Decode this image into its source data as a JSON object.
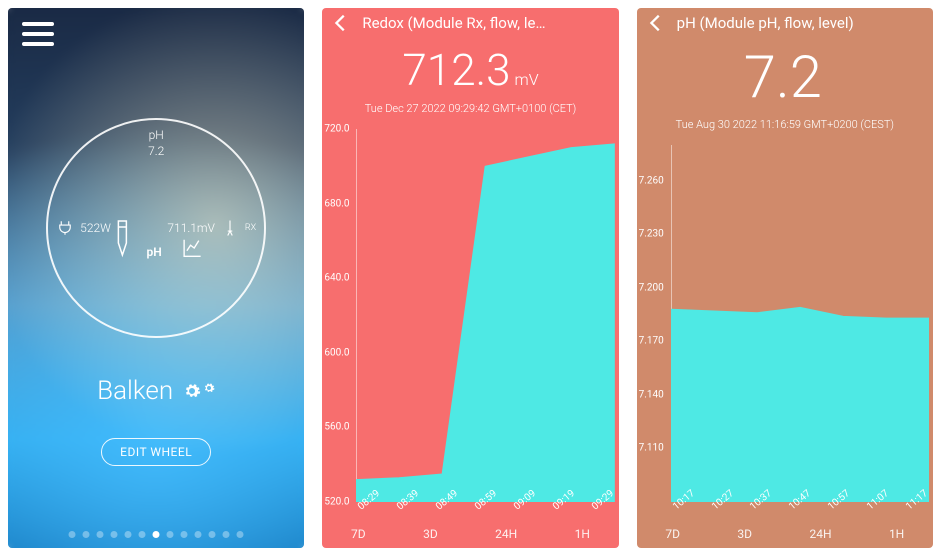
{
  "home": {
    "title": "Balken",
    "edit_label": "EDIT WHEEL",
    "wheel": {
      "ph_label": "pH",
      "ph_value": "7.2",
      "watt_value": "522W",
      "redox_value": "711.1mV",
      "rx_label": "RX",
      "center_ph_label": "pH"
    },
    "dots_total": 13,
    "dots_active_index": 6
  },
  "redox": {
    "title": "Redox (Module Rx, flow, le…",
    "value": "712.3",
    "unit": "mV",
    "timestamp": "Tue Dec 27 2022 09:29:42 GMT+0100 (CET)",
    "ranges": [
      "7D",
      "3D",
      "24H",
      "1H"
    ]
  },
  "ph": {
    "title": "pH (Module pH, flow, level)",
    "value": "7.2",
    "unit": "",
    "timestamp": "Tue Aug 30 2022 11:16:59 GMT+0200 (CEST)",
    "ranges": [
      "7D",
      "3D",
      "24H",
      "1H"
    ]
  },
  "chart_data": [
    {
      "type": "area",
      "title": "Redox (Module Rx, flow, level)",
      "ylabel": "mV",
      "ylim": [
        520,
        720
      ],
      "yticks": [
        520,
        560,
        600,
        640,
        680,
        720
      ],
      "x": [
        "08:29",
        "08:39",
        "08:49",
        "08:59",
        "09:09",
        "09:19",
        "09:29"
      ],
      "values": [
        532,
        533,
        535,
        700,
        705,
        710,
        712
      ],
      "color": "#4ee9e4",
      "bg": "#f76e6e"
    },
    {
      "type": "area",
      "title": "pH (Module pH, flow, level)",
      "ylabel": "pH",
      "ylim": [
        7.08,
        7.28
      ],
      "yticks": [
        7.11,
        7.14,
        7.17,
        7.2,
        7.23,
        7.26
      ],
      "x": [
        "10:17",
        "10:27",
        "10:37",
        "10:47",
        "10:57",
        "11:07",
        "11:17"
      ],
      "values": [
        7.188,
        7.187,
        7.186,
        7.189,
        7.184,
        7.183,
        7.183
      ],
      "color": "#4ee9e4",
      "bg": "#d08a6b"
    }
  ]
}
